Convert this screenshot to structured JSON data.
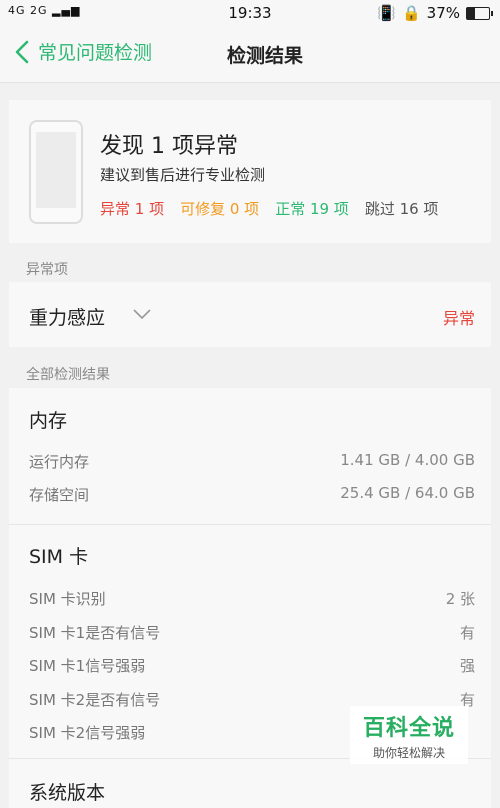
{
  "status_bar": {
    "network": "4G 2G",
    "time": "19:33",
    "battery": "37%",
    "battery_level": 0.37
  },
  "header": {
    "back_label": "常见问题检测",
    "title": "检测结果"
  },
  "summary": {
    "title": "发现 1 项异常",
    "subtitle": "建议到售后进行专业检测",
    "counts": [
      {
        "text": "异常 1 项",
        "color": "#e5463c"
      },
      {
        "text": "可修复 0 项",
        "color": "#f29a1f"
      },
      {
        "text": "正常 19 项",
        "color": "#2eb873"
      },
      {
        "text": "跳过 16 项",
        "color": "#555555"
      }
    ]
  },
  "anomaly_section": {
    "label": "异常项",
    "item_name": "重力感应",
    "item_status": "异常"
  },
  "all_results": {
    "label": "全部检测结果",
    "memory": {
      "title": "内存",
      "rows": [
        {
          "label": "运行内存",
          "value": "1.41 GB / 4.00 GB"
        },
        {
          "label": "存储空间",
          "value": "25.4 GB / 64.0 GB"
        }
      ]
    },
    "sim": {
      "title": "SIM 卡",
      "rows": [
        {
          "label": "SIM 卡识别",
          "value": "2 张"
        },
        {
          "label": "SIM 卡1是否有信号",
          "value": "有"
        },
        {
          "label": "SIM 卡1信号强弱",
          "value": "强"
        },
        {
          "label": "SIM 卡2是否有信号",
          "value": "有"
        },
        {
          "label": "SIM 卡2信号强弱",
          "value": ""
        }
      ]
    },
    "next_group_title": "系统版本"
  },
  "watermark": {
    "title": "百科全说",
    "subtitle": "助你轻松解决"
  }
}
